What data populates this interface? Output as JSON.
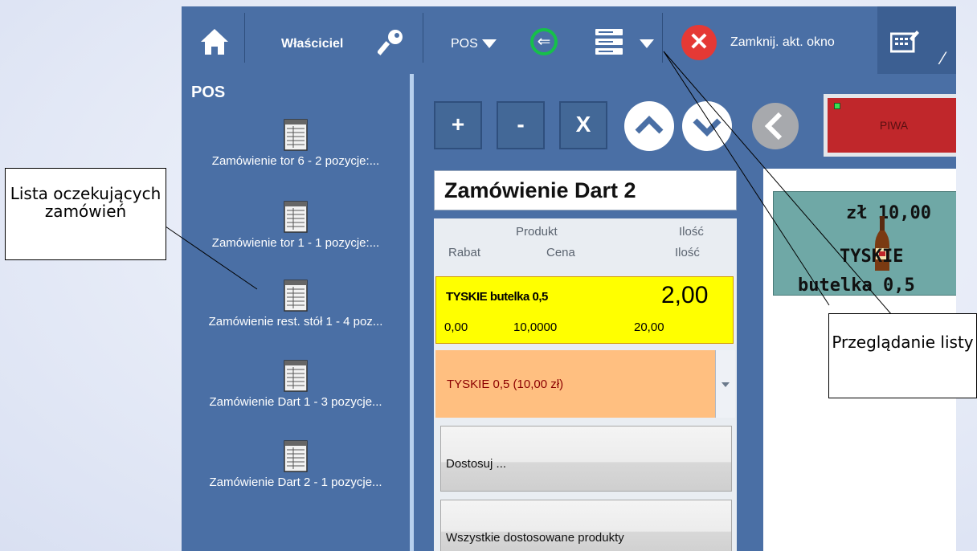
{
  "topbar": {
    "owner_label": "Właściciel",
    "pos_label": "POS",
    "close_label": "Zamknij. akt. okno",
    "back_glyph": "⇐"
  },
  "sidebar": {
    "title": "POS",
    "orders": [
      {
        "label": "Zamówienie tor 6 - 2 pozycje:..."
      },
      {
        "label": "Zamówienie tor 1 - 1 pozycje:..."
      },
      {
        "label": "Zamówienie rest. stół 1 - 4 poz..."
      },
      {
        "label": "Zamówienie Dart 1 - 3 pozycje..."
      },
      {
        "label": "Zamówienie Dart 2 - 1 pozycje..."
      }
    ]
  },
  "toolbar": {
    "plus": "+",
    "minus": "-",
    "delete": "X",
    "category_label": "PIWA"
  },
  "order": {
    "name": "Zamówienie Dart 2"
  },
  "grid": {
    "headers_row1": {
      "product": "Produkt",
      "quantity": "Ilość"
    },
    "headers_row2": {
      "discount": "Rabat",
      "price": "Cena",
      "quantity": "Ilość"
    },
    "item": {
      "name": "TYSKIE butelka 0,5",
      "quantity": "2,00",
      "discount": "0,00",
      "price": "10,0000",
      "total": "20,00"
    },
    "combo_value": "TYSKIE 0,5 (10,00 zł)",
    "customize_label": "Dostosuj ...",
    "all_customized_label": "Wszystkie dostosowane produkty"
  },
  "product_tile": {
    "price": "zł 10,00",
    "name": "TYSKIE",
    "size": "butelka 0,5"
  },
  "annotations": {
    "pending_orders": "Lista oczekujących zamówień",
    "browse_list": "Przeglądanie listy"
  },
  "colors": {
    "app_blue": "#4a6fa5",
    "selected_row": "#ffff00",
    "combo_bg": "#ffbf80",
    "category_red": "#c0272b",
    "close_red": "#e53935",
    "back_green": "#16c04a"
  }
}
